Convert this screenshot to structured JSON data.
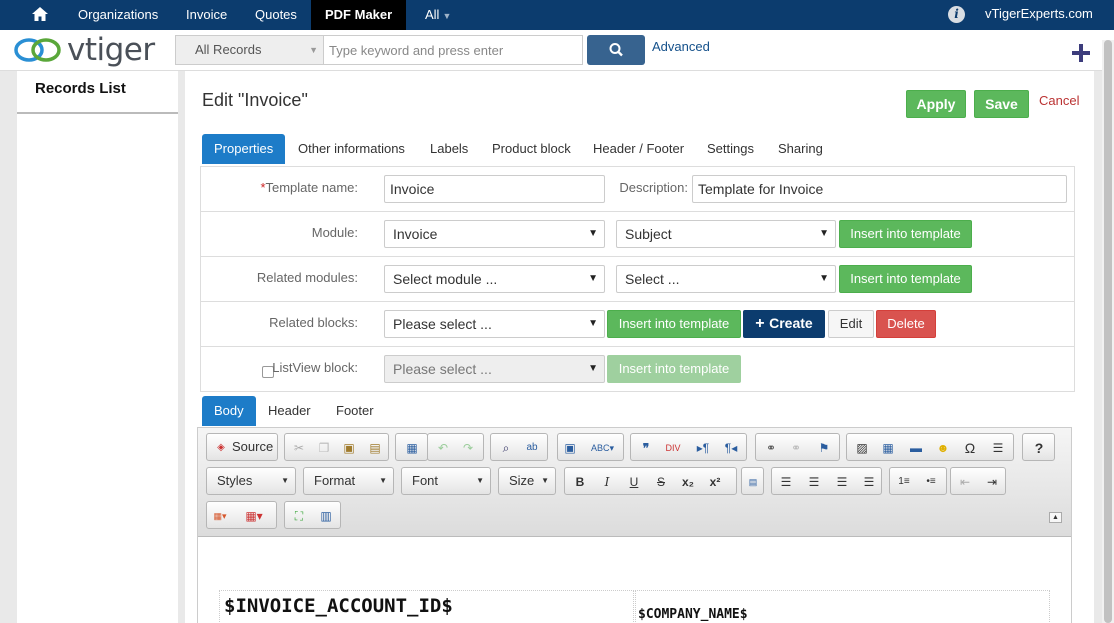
{
  "topnav": {
    "items": [
      "Organizations",
      "Invoice",
      "Quotes",
      "PDF Maker",
      "All"
    ],
    "account": "vTigerExperts.com"
  },
  "header": {
    "logo_text": "vtiger",
    "search_scope": "All Records",
    "search_placeholder": "Type keyword and press enter",
    "advanced_label": "Advanced"
  },
  "sidebar": {
    "title": "Records List"
  },
  "page": {
    "title": "Edit \"Invoice\"",
    "apply_label": "Apply",
    "save_label": "Save",
    "cancel_label": "Cancel"
  },
  "tabs": [
    "Properties",
    "Other informations",
    "Labels",
    "Product block",
    "Header / Footer",
    "Settings",
    "Sharing"
  ],
  "form": {
    "template_name_label": "Template name:",
    "template_name_value": "Invoice",
    "description_label": "Description:",
    "description_value": "Template for Invoice",
    "module_label": "Module:",
    "module_value": "Invoice",
    "module_field_value": "Subject",
    "related_modules_label": "Related modules:",
    "related_modules_value": "Select module ...",
    "related_field_value": "Select ...",
    "related_blocks_label": "Related blocks:",
    "related_blocks_value": "Please select ...",
    "listview_label": "ListView block:",
    "listview_value": "Please select ...",
    "insert_label": "Insert into template",
    "create_label": "Create",
    "edit_label": "Edit",
    "delete_label": "Delete"
  },
  "body_tabs": [
    "Body",
    "Header",
    "Footer"
  ],
  "editor": {
    "source_label": "Source",
    "styles_label": "Styles",
    "format_label": "Format",
    "font_label": "Font",
    "size_label": "Size",
    "content_left": "$INVOICE_ACCOUNT_ID$",
    "content_right": "$COMPANY_NAME$"
  },
  "colors": {
    "nav": "#0c3c6e",
    "primary_tab": "#1d7cc8",
    "success": "#5cb85c",
    "danger": "#d9534f"
  }
}
